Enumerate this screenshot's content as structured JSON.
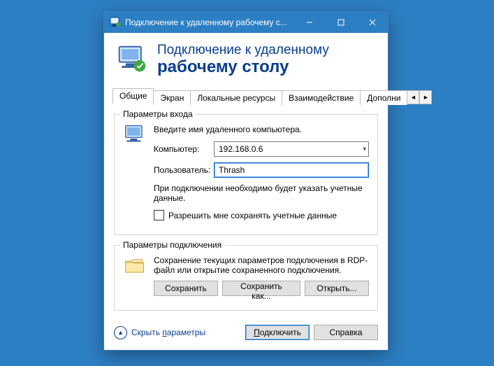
{
  "titlebar": {
    "title": "Подключение к удаленному рабочему с..."
  },
  "header": {
    "line1": "Подключение к удаленному",
    "line2": "рабочему столу"
  },
  "tabs": {
    "items": [
      {
        "label": "Общие"
      },
      {
        "label": "Экран"
      },
      {
        "label": "Локальные ресурсы"
      },
      {
        "label": "Взаимодействие"
      },
      {
        "label": "Дополни"
      }
    ]
  },
  "group_login": {
    "legend": "Параметры входа",
    "intro": "Введите имя удаленного компьютера.",
    "computer_label": "Компьютер:",
    "computer_value": "192.168.0.6",
    "user_label": "Пользователь:",
    "user_value": "Thrash",
    "note": "При подключении необходимо будет указать учетные данные.",
    "checkbox_label": "Разрешить мне сохранять учетные данные"
  },
  "group_conn": {
    "legend": "Параметры подключения",
    "note": "Сохранение текущих параметров подключения в RDP-файл или открытие сохраненного подключения.",
    "save": "Сохранить",
    "save_as": "Сохранить как...",
    "open": "Открыть..."
  },
  "footer": {
    "hide_prefix": "Скрыть ",
    "hide_underlined": "п",
    "hide_suffix": "араметры",
    "connect_prefix": "",
    "connect_underlined": "П",
    "connect_suffix": "одключить",
    "help": "Справка"
  }
}
